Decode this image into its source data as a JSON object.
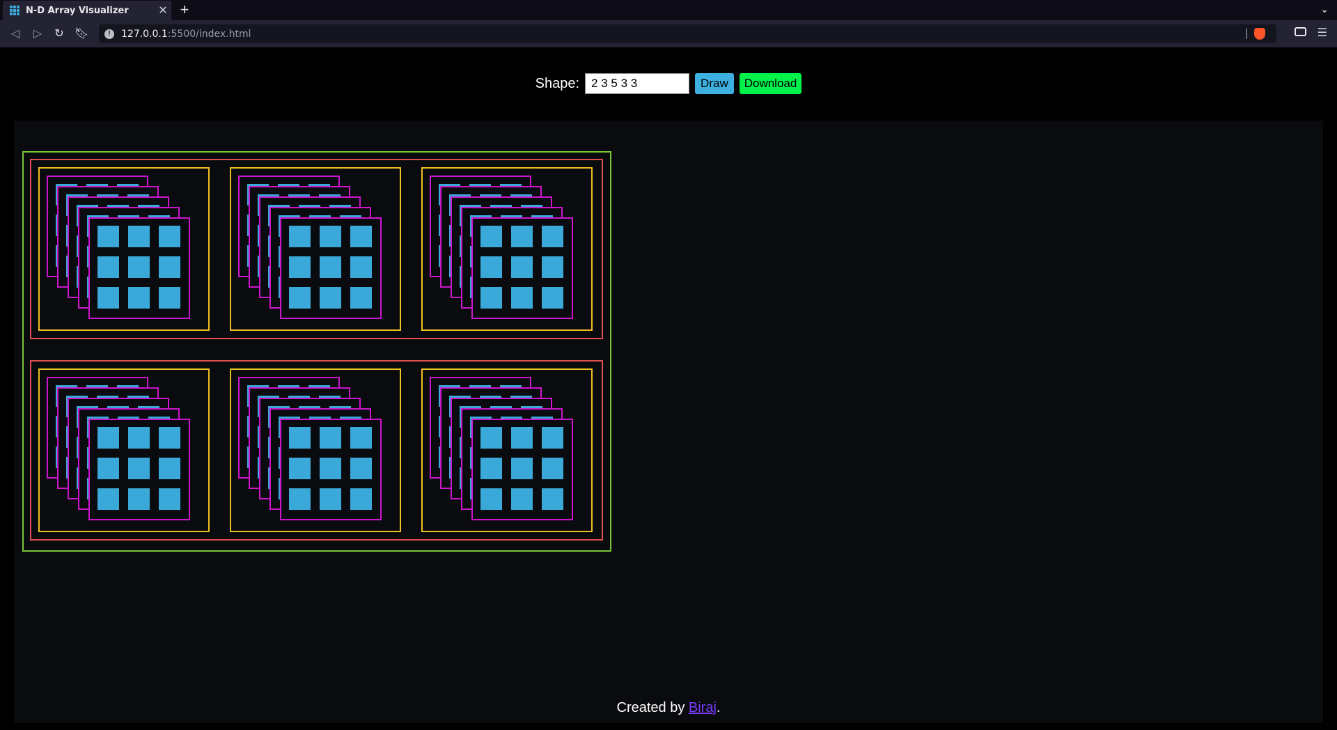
{
  "browser": {
    "tab_title": "N-D Array Visualizer",
    "new_tab": "+",
    "url_host": "127.0.0.1",
    "url_rest": ":5500/index.html"
  },
  "controls": {
    "shape_label": "Shape:",
    "shape_value": "2 3 5 3 3",
    "draw_label": "Draw",
    "download_label": "Download"
  },
  "visual": {
    "shape": [
      2,
      3,
      5,
      3,
      3
    ],
    "level_colors": [
      "#76c83a",
      "#e05050",
      "#f0c020",
      "#cc16cc",
      "#3aa8d8"
    ]
  },
  "footer": {
    "prefix": "Created by ",
    "author": "Biraj",
    "suffix": "."
  }
}
